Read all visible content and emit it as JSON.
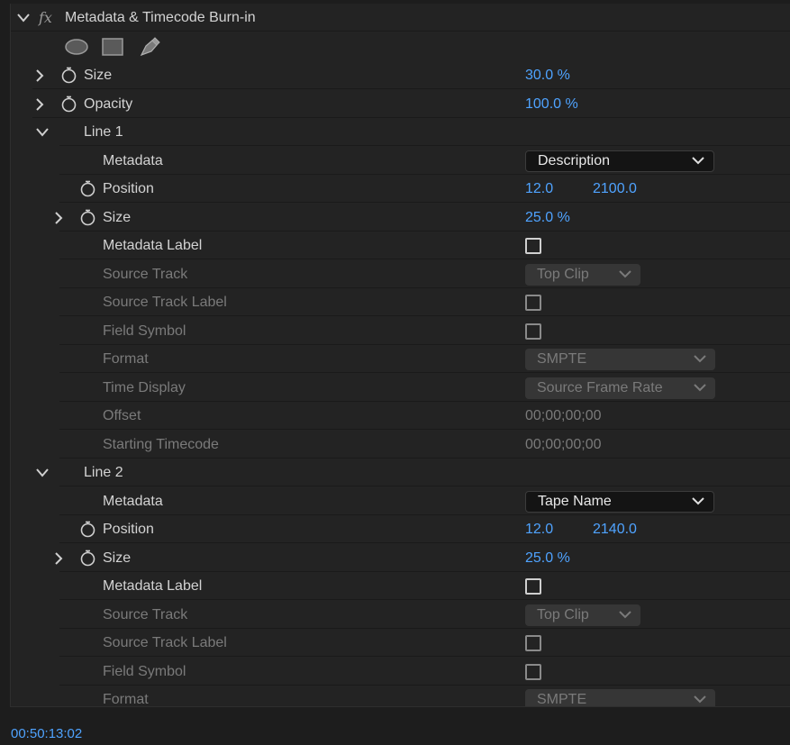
{
  "effect": {
    "title": "Metadata & Timecode Burn-in",
    "fx_label": "fx",
    "mask_tools": [
      "ellipse-mask-icon",
      "rectangle-mask-icon",
      "pen-mask-icon"
    ]
  },
  "size": {
    "label": "Size",
    "value": "30.0 %"
  },
  "opacity": {
    "label": "Opacity",
    "value": "100.0 %"
  },
  "line1": {
    "label": "Line 1",
    "metadata": {
      "label": "Metadata",
      "value": "Description"
    },
    "position": {
      "label": "Position",
      "x": "12.0",
      "y": "2100.0"
    },
    "size": {
      "label": "Size",
      "value": "25.0 %"
    },
    "metadata_label": {
      "label": "Metadata Label",
      "checked": false
    },
    "source_track": {
      "label": "Source Track",
      "value": "Top Clip"
    },
    "source_track_label": {
      "label": "Source Track Label",
      "checked": false
    },
    "field_symbol": {
      "label": "Field Symbol",
      "checked": false
    },
    "format": {
      "label": "Format",
      "value": "SMPTE"
    },
    "time_display": {
      "label": "Time Display",
      "value": "Source Frame Rate"
    },
    "offset": {
      "label": "Offset",
      "value": "00;00;00;00"
    },
    "starting_timecode": {
      "label": "Starting Timecode",
      "value": "00;00;00;00"
    }
  },
  "line2": {
    "label": "Line 2",
    "metadata": {
      "label": "Metadata",
      "value": "Tape Name"
    },
    "position": {
      "label": "Position",
      "x": "12.0",
      "y": "2140.0"
    },
    "size": {
      "label": "Size",
      "value": "25.0 %"
    },
    "metadata_label": {
      "label": "Metadata Label",
      "checked": false
    },
    "source_track": {
      "label": "Source Track",
      "value": "Top Clip"
    },
    "source_track_label": {
      "label": "Source Track Label",
      "checked": false
    },
    "field_symbol": {
      "label": "Field Symbol",
      "checked": false
    },
    "format": {
      "label": "Format",
      "value": "SMPTE"
    }
  },
  "footer": {
    "timecode": "00:50:13:02"
  },
  "colors": {
    "value_blue": "#4fa3ff",
    "panel_bg": "#232323",
    "disabled_text": "#7a7a7a"
  }
}
